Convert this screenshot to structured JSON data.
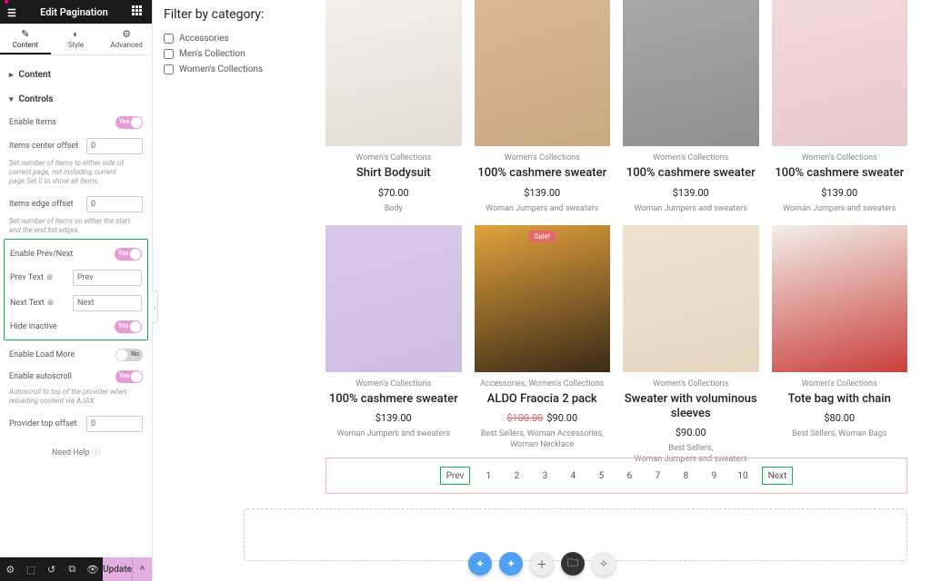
{
  "sidebar": {
    "title": "Edit Pagination",
    "tabs": {
      "content": "Content",
      "style": "Style",
      "advanced": "Advanced"
    },
    "sections": {
      "content": "Content",
      "controls": "Controls"
    },
    "controls": {
      "enable_items": {
        "label": "Enable Items",
        "value": true
      },
      "items_center_offset": {
        "label": "Items center offset",
        "value": "0",
        "help": "Set number of items to either side of current page, not including current page.Set 0 to show all items."
      },
      "items_edge_offset": {
        "label": "Items edge offset",
        "value": "0",
        "help": "Set number of items on either the start and the end list edges."
      },
      "enable_prevnext": {
        "label": "Enable Prev/Next",
        "value": true
      },
      "prev_text": {
        "label": "Prev Text",
        "value": "Prev"
      },
      "next_text": {
        "label": "Next Text",
        "value": "Next"
      },
      "hide_inactive": {
        "label": "Hide inactive",
        "value": true
      },
      "enable_load_more": {
        "label": "Enable Load More",
        "value": false
      },
      "enable_autoscroll": {
        "label": "Enable autoscroll",
        "value": true,
        "help": "Autoscroll to top of the provider when reloading content via AJAX."
      },
      "provider_top_offset": {
        "label": "Provider top offset",
        "value": "0"
      }
    },
    "need_help": "Need Help",
    "footer": {
      "update": "Update"
    }
  },
  "filter": {
    "heading": "Filter by category:",
    "items": [
      "Accessories",
      "Men's Collection",
      "Women's Collections"
    ]
  },
  "products": [
    {
      "cat": "Women's Collections",
      "name": "Shirt Bodysuit",
      "price": "$70.00",
      "tags": "Body",
      "tint": "linear-gradient(165deg,#f5f0ea,#e3dcd4)"
    },
    {
      "cat": "Women's Collections",
      "name": "100% cashmere sweater",
      "price": "$139.00",
      "tags": "Woman Jumpers and sweaters",
      "tint": "linear-gradient(165deg,#d9b995,#c8a981)"
    },
    {
      "cat": "Women's Collections",
      "name": "100% cashmere sweater",
      "price": "$139.00",
      "tags": "Woman Jumpers and sweaters",
      "tint": "linear-gradient(165deg,#a8a8a8,#8f8f8f)"
    },
    {
      "cat": "Women's Collections",
      "name": "100% cashmere sweater",
      "price": "$139.00",
      "tags": "Woman Jumpers and sweaters",
      "tint": "linear-gradient(165deg,#f2d9dc,#e7c8cc)"
    },
    {
      "cat": "Women's Collections",
      "name": "100% cashmere sweater",
      "price": "$139.00",
      "tags": "Woman Jumpers and sweaters",
      "tint": "linear-gradient(165deg,#d9c9e8,#cdbde0)"
    },
    {
      "cat": "Accessories, Women's Collections",
      "name": "ALDO Fraocia 2 pack",
      "price": "$90.00",
      "old": "$100.00",
      "tags": "Best Sellers, Woman Accessories, Woman Necklace",
      "sale": "Sale!",
      "tint": "linear-gradient(165deg,#e0a23c,#3b2a17)"
    },
    {
      "cat": "Women's Collections",
      "name": "Sweater with voluminous sleeves",
      "price": "$90.00",
      "tags": "Best Sellers,\nWoman Jumpers and sweaters",
      "tint": "linear-gradient(165deg,#efe2cf,#e4d6c1)"
    },
    {
      "cat": "Women's Collections",
      "name": "Tote bag with chain",
      "price": "$80.00",
      "tags": "Best Sellers, Woman Bags",
      "tint": "linear-gradient(165deg,#f2efe9,#c9403c)"
    }
  ],
  "pagination": {
    "prev": "Prev",
    "next": "Next",
    "pages": [
      "1",
      "2",
      "3",
      "4",
      "5",
      "6",
      "7",
      "8",
      "9",
      "10"
    ]
  }
}
